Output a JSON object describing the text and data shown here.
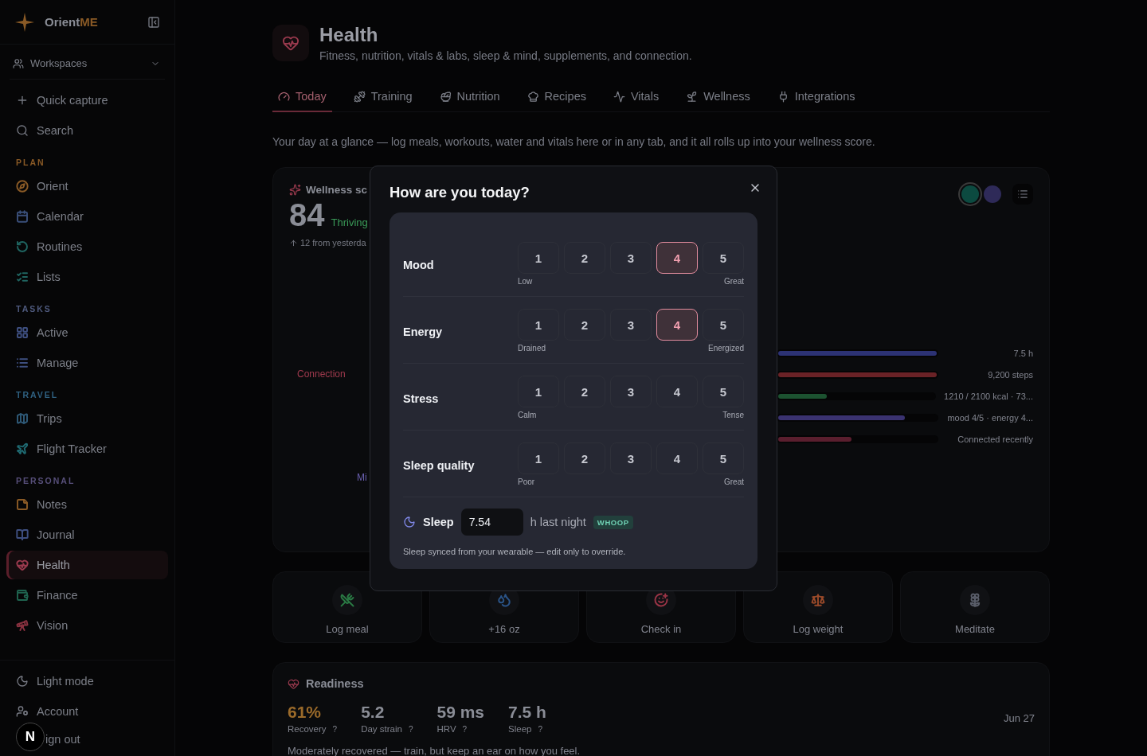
{
  "sidebar": {
    "brand": {
      "name": "Orient",
      "accent": "ME"
    },
    "workspaces": "Workspaces",
    "actions": [
      {
        "label": "Quick capture"
      },
      {
        "label": "Search"
      }
    ],
    "sections": [
      {
        "title": "PLAN",
        "color": "#8a5a26",
        "items": [
          {
            "label": "Orient",
            "color": "#8a5a26",
            "selected": false
          },
          {
            "label": "Calendar",
            "color": "#3a4f7a",
            "selected": false
          },
          {
            "label": "Routines",
            "color": "#1f6460",
            "selected": false
          },
          {
            "label": "Lists",
            "color": "#1f6460",
            "selected": false
          }
        ]
      },
      {
        "title": "TASKS",
        "color": "#4f5a7e",
        "items": [
          {
            "label": "Active",
            "color": "#3e4f80",
            "selected": false
          },
          {
            "label": "Manage",
            "color": "#3e4f80",
            "selected": false
          }
        ]
      },
      {
        "title": "TRAVEL",
        "color": "#2f6080",
        "items": [
          {
            "label": "Trips",
            "color": "#2f5a78",
            "selected": false
          },
          {
            "label": "Flight Tracker",
            "color": "#1f6a72",
            "selected": false
          }
        ]
      },
      {
        "title": "PERSONAL",
        "color": "#574f7a",
        "items": [
          {
            "label": "Notes",
            "color": "#8a5a26",
            "selected": false
          },
          {
            "label": "Journal",
            "color": "#3e4f80",
            "selected": false
          },
          {
            "label": "Health",
            "color": "#9a3a4e",
            "selected": true
          },
          {
            "label": "Finance",
            "color": "#1f6450",
            "selected": false
          },
          {
            "label": "Vision",
            "color": "#8a3240",
            "selected": false
          }
        ]
      }
    ],
    "footer": [
      {
        "label": "Light mode"
      },
      {
        "label": "Account"
      },
      {
        "label": "ign out"
      }
    ],
    "dev_badge": "N"
  },
  "header": {
    "title": "Health",
    "subtitle": "Fitness, nutrition, vitals & labs, sleep & mind, supplements, and connection."
  },
  "tabs": [
    {
      "label": "Today",
      "selected": true
    },
    {
      "label": "Training",
      "selected": false
    },
    {
      "label": "Nutrition",
      "selected": false
    },
    {
      "label": "Recipes",
      "selected": false
    },
    {
      "label": "Vitals",
      "selected": false
    },
    {
      "label": "Wellness",
      "selected": false
    },
    {
      "label": "Integrations",
      "selected": false
    }
  ],
  "intro": "Your day at a glance — log meals, workouts, water and vitals here or in any tab, and it all rolls up into your wellness score.",
  "wellness": {
    "title": "Wellness sc",
    "score": "84",
    "status": "Thriving",
    "delta": "12 from yesterda",
    "radar_labels": [
      {
        "label": "Connection",
        "color": "#a03a4e"
      },
      {
        "label": "Mi",
        "color": "#6a60b0"
      }
    ],
    "swatches": [
      {
        "color": "#0c4a40",
        "selected": true
      },
      {
        "color": "#2e2a58",
        "selected": false
      }
    ],
    "bars": [
      {
        "level": 1,
        "color": "#2c3274",
        "reading": "7.5 h"
      },
      {
        "level": 1,
        "color": "#6a2226",
        "reading": "9,200 steps"
      },
      {
        "level": 0.31,
        "color": "#1c5230",
        "reading": "1210 / 2100 kcal · 73..."
      },
      {
        "level": 0.8,
        "color": "#3a3270",
        "reading": "mood 4/5 · energy 4..."
      },
      {
        "level": 0.46,
        "color": "#5a1e2e",
        "reading": "Connected recently"
      }
    ]
  },
  "quick_actions": [
    {
      "label": "Log meal",
      "color": "#2a7a44"
    },
    {
      "label": "+16 oz",
      "color": "#2a5488"
    },
    {
      "label": "Check in",
      "color": "#9a3446"
    },
    {
      "label": "Log weight",
      "color": "#9a4a2a"
    },
    {
      "label": "Meditate",
      "color": "#5a5e6a"
    }
  ],
  "readiness": {
    "title": "Readiness",
    "date": "Jun 27",
    "metrics": [
      {
        "value": "61%",
        "label": "Recovery",
        "help": "?",
        "kind": "accent"
      },
      {
        "value": "5.2",
        "label": "Day strain",
        "help": "?",
        "kind": "plain"
      },
      {
        "value": "59 ms",
        "label": "HRV",
        "help": "?",
        "kind": "plain"
      },
      {
        "value": "7.5 h",
        "label": "Sleep",
        "help": "?",
        "kind": "plain"
      }
    ],
    "note": "Moderately recovered — train, but keep an ear on how you feel."
  },
  "dialog": {
    "title": "How are you today?",
    "ratings": [
      {
        "label": "Mood",
        "low": "Low",
        "high": "Great",
        "options": [
          {
            "label": "1",
            "selected": false
          },
          {
            "label": "2",
            "selected": false
          },
          {
            "label": "3",
            "selected": false
          },
          {
            "label": "4",
            "selected": true
          },
          {
            "label": "5",
            "selected": false
          }
        ]
      },
      {
        "label": "Energy",
        "low": "Drained",
        "high": "Energized",
        "options": [
          {
            "label": "1",
            "selected": false
          },
          {
            "label": "2",
            "selected": false
          },
          {
            "label": "3",
            "selected": false
          },
          {
            "label": "4",
            "selected": true
          },
          {
            "label": "5",
            "selected": false
          }
        ]
      },
      {
        "label": "Stress",
        "low": "Calm",
        "high": "Tense",
        "options": [
          {
            "label": "1",
            "selected": false
          },
          {
            "label": "2",
            "selected": false
          },
          {
            "label": "3",
            "selected": false
          },
          {
            "label": "4",
            "selected": false
          },
          {
            "label": "5",
            "selected": false
          }
        ]
      },
      {
        "label": "Sleep quality",
        "low": "Poor",
        "high": "Great",
        "options": [
          {
            "label": "1",
            "selected": false
          },
          {
            "label": "2",
            "selected": false
          },
          {
            "label": "3",
            "selected": false
          },
          {
            "label": "4",
            "selected": false
          },
          {
            "label": "5",
            "selected": false
          }
        ]
      }
    ],
    "sleep": {
      "label": "Sleep",
      "value": "7.54",
      "unit": "h last night",
      "source": "WHOOP"
    },
    "note": "Sleep synced from your wearable — edit only to override."
  }
}
